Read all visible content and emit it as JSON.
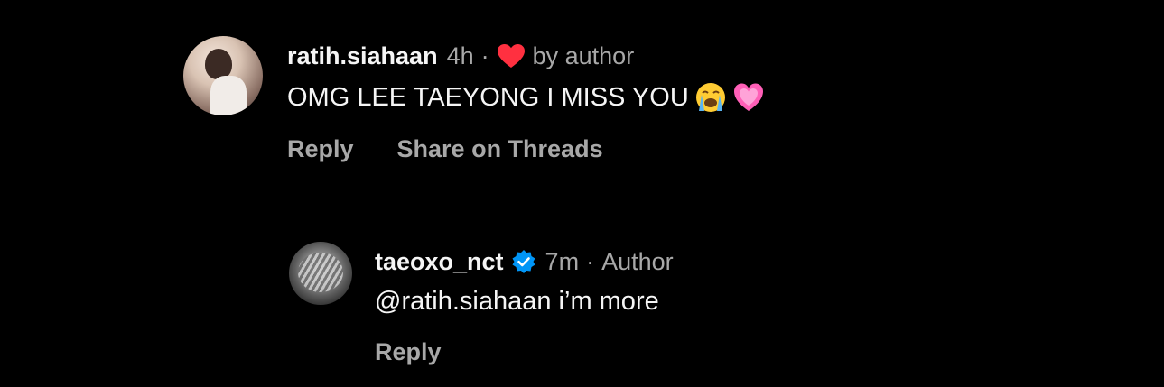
{
  "comments": [
    {
      "username": "ratih.siahaan",
      "time": "4h",
      "separator": "·",
      "liked_by_author": "by author",
      "text": "OMG LEE TAEYONG I MISS YOU",
      "emojis": [
        "loudly-crying-face",
        "growing-heart"
      ],
      "actions": {
        "reply": "Reply",
        "share": "Share on Threads"
      }
    },
    {
      "username": "taeoxo_nct",
      "time": "7m",
      "separator": "·",
      "author_label": "Author",
      "text": "@ratih.siahaan i’m more",
      "actions": {
        "reply": "Reply"
      }
    }
  ],
  "colors": {
    "background": "#000000",
    "text_primary": "#f5f5f5",
    "text_secondary": "#a8a8a8",
    "heart": "#ff3040",
    "verified": "#0095f6"
  }
}
